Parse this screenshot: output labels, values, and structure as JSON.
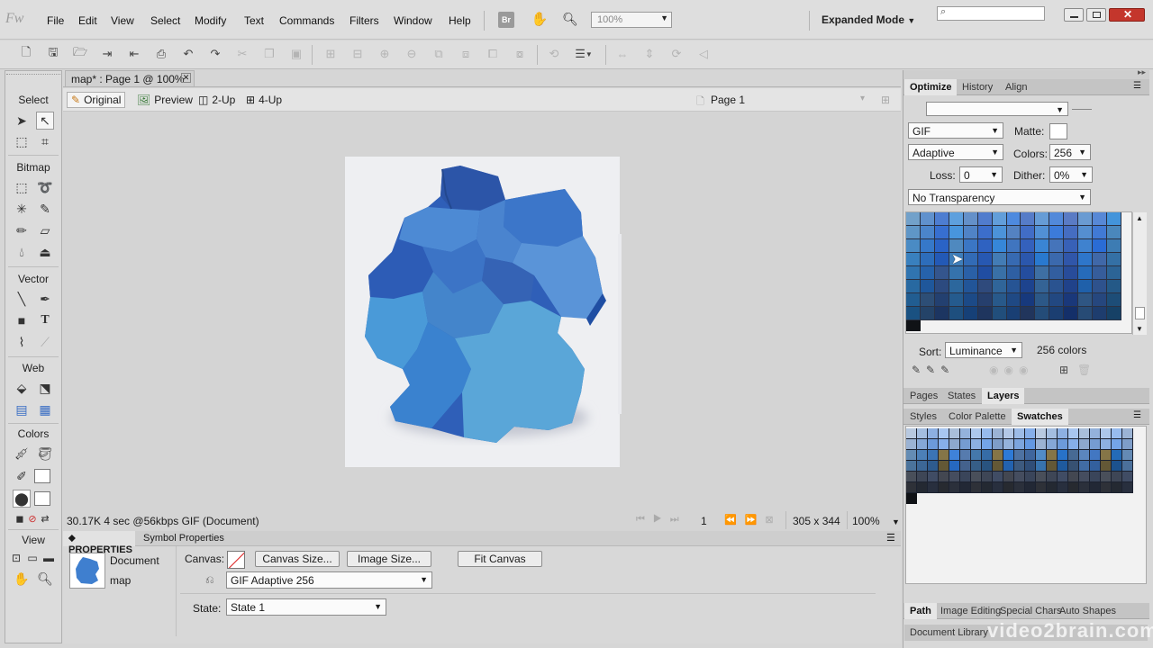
{
  "app": {
    "logo": "Fw",
    "menus": [
      "File",
      "Edit",
      "View",
      "Select",
      "Modify",
      "Text",
      "Commands",
      "Filters",
      "Window",
      "Help"
    ],
    "zoom": "100%",
    "workspace_mode": "Expanded Mode",
    "bridge_label": "Br"
  },
  "document": {
    "tab_title": "map* : Page 1 @ 100%",
    "view_tabs": [
      "Original",
      "Preview",
      "2-Up",
      "4-Up"
    ],
    "page_name": "Page 1",
    "status": {
      "info": "30.17K  4 sec @56kbps  GIF (Document)",
      "frame": "1",
      "size": "305 x 344",
      "zoom": "100%"
    }
  },
  "tools": {
    "sections": [
      "Select",
      "Bitmap",
      "Vector",
      "Web",
      "Colors",
      "View"
    ]
  },
  "properties": {
    "tabs": [
      "PROPERTIES",
      "Symbol Properties"
    ],
    "doc_type": "Document",
    "doc_name": "map",
    "canvas_label": "Canvas:",
    "canvas_size_btn": "Canvas Size...",
    "image_size_btn": "Image Size...",
    "fit_canvas_btn": "Fit Canvas",
    "export_setting": "GIF Adaptive 256",
    "state_label": "State:",
    "state_value": "State 1"
  },
  "optimize": {
    "tabs": [
      "Optimize",
      "History",
      "Align"
    ],
    "format": "GIF",
    "matte_label": "Matte:",
    "palette": "Adaptive",
    "colors_label": "Colors:",
    "colors_value": "256",
    "loss_label": "Loss:",
    "loss_value": "0",
    "dither_label": "Dither:",
    "dither_value": "0%",
    "transparency": "No Transparency",
    "sort_label": "Sort:",
    "sort_value": "Luminance",
    "color_count": "256 colors"
  },
  "pages_panel": {
    "tabs": [
      "Pages",
      "States",
      "Layers"
    ]
  },
  "swatches_panel": {
    "tabs": [
      "Styles",
      "Color Palette",
      "Swatches"
    ]
  },
  "bottom_panels": {
    "tabs": [
      "Path",
      "Image Editing",
      "Special Chars",
      "Auto Shapes"
    ],
    "library": "Document Library"
  },
  "watermark": "video2brain.com"
}
